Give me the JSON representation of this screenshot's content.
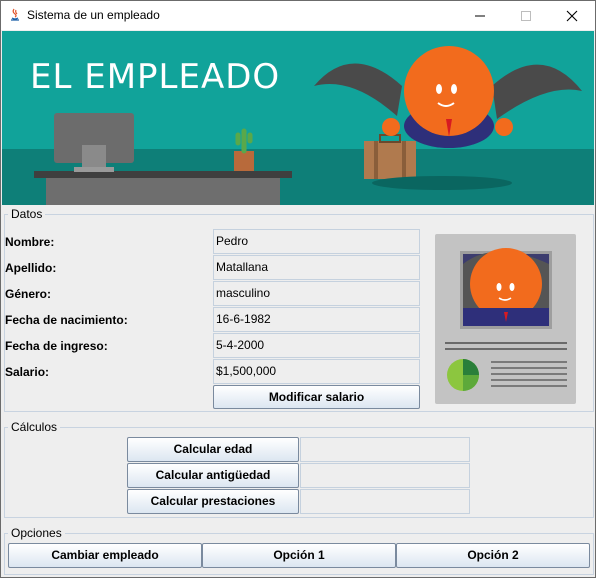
{
  "window": {
    "title": "Sistema de un empleado"
  },
  "banner": {
    "title": "EL EMPLEADO"
  },
  "datos": {
    "legend": "Datos",
    "fields": [
      {
        "label": "Nombre:",
        "value": "Pedro"
      },
      {
        "label": "Apellido:",
        "value": "Matallana"
      },
      {
        "label": "Género:",
        "value": "masculino"
      },
      {
        "label": "Fecha de nacimiento:",
        "value": "16-6-1982"
      },
      {
        "label": "Fecha de ingreso:",
        "value": "5-4-2000"
      },
      {
        "label": "Salario:",
        "value": "$1,500,000"
      }
    ],
    "modify_salary_label": "Modificar salario"
  },
  "calculos": {
    "legend": "Cálculos",
    "buttons": [
      "Calcular edad",
      "Calcular antigüedad",
      "Calcular prestaciones"
    ],
    "results": [
      "",
      "",
      ""
    ]
  },
  "opciones": {
    "legend": "Opciones",
    "buttons": [
      "Cambiar empleado",
      "Opción 1",
      "Opción 2"
    ]
  },
  "colors": {
    "banner_teal": "#11a39a",
    "banner_floor": "#0e7f78",
    "mascot_orange": "#f26b1d",
    "accent_border": "#c8d3e0"
  }
}
